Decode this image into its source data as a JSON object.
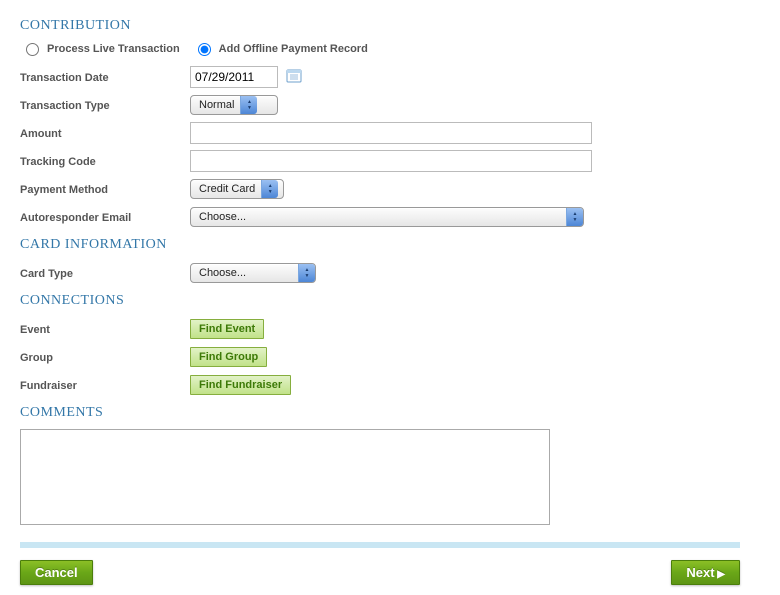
{
  "headings": {
    "contribution": "CONTRIBUTION",
    "card_information": "CARD INFORMATION",
    "connections": "CONNECTIONS",
    "comments": "COMMENTS"
  },
  "contribution": {
    "process_live_label": "Process Live Transaction",
    "add_offline_label": "Add Offline Payment Record",
    "selected": "offline",
    "transaction_date_label": "Transaction Date",
    "transaction_date_value": "07/29/2011",
    "transaction_type_label": "Transaction Type",
    "transaction_type_value": "Normal",
    "amount_label": "Amount",
    "amount_value": "",
    "tracking_code_label": "Tracking Code",
    "tracking_code_value": "",
    "payment_method_label": "Payment Method",
    "payment_method_value": "Credit Card",
    "autoresponder_label": "Autoresponder Email",
    "autoresponder_value": "Choose..."
  },
  "card": {
    "card_type_label": "Card Type",
    "card_type_value": "Choose..."
  },
  "connections": {
    "event_label": "Event",
    "event_button": "Find Event",
    "group_label": "Group",
    "group_button": "Find Group",
    "fundraiser_label": "Fundraiser",
    "fundraiser_button": "Find Fundraiser"
  },
  "comments": {
    "value": ""
  },
  "footer": {
    "cancel": "Cancel",
    "next": "Next"
  }
}
